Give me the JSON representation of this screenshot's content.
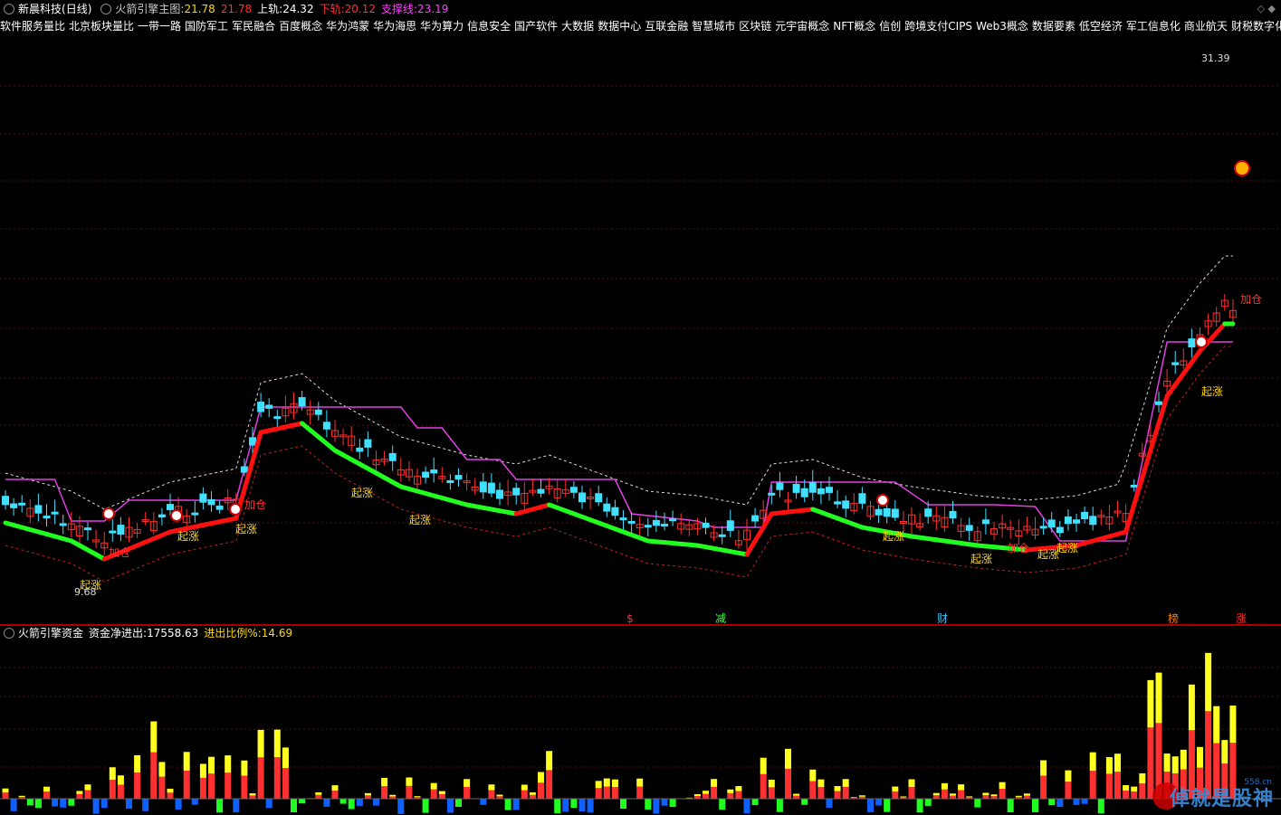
{
  "header": {
    "stock": "新晨科技",
    "period": "(日线)",
    "indicator": "火箭引擎主图",
    "close_prefix": ":",
    "close_value": "21.78",
    "close_value2": "21.78",
    "upper_label": "上轨:",
    "upper_value": "24.32",
    "lower_label": "下轨:",
    "lower_value": "20.12",
    "support_label": "支撑线:",
    "support_value": "23.19"
  },
  "concepts": [
    "软件服务量比",
    "北京板块量比",
    "一带一路",
    "国防军工",
    "军民融合",
    "百度概念",
    "华为鸿蒙",
    "华为海思",
    "华为算力",
    "信息安全",
    "国产软件",
    "大数据",
    "数据中心",
    "互联金融",
    "智慧城市",
    "区块链",
    "元宇宙概念",
    "NFT概念",
    "信创",
    "跨境支付CIPS",
    "Web3概念",
    "数据要素",
    "低空经济",
    "军工信息化",
    "商业航天",
    "财税数字化"
  ],
  "sub_header": {
    "indicator": "火箭引擎资金",
    "net_label": "资金净进出:",
    "net_value": "17558.63",
    "ratio_label": "进出比例%:",
    "ratio_value": "14.69"
  },
  "markers": {
    "max_price": "31.39",
    "min_price": "9.68",
    "qizhang": "起涨",
    "jiacang": "加仓",
    "bottom_events": [
      "$",
      "减",
      "财",
      "榜",
      "涨"
    ]
  },
  "watermark": {
    "text": "倬就是股神",
    "small": "558.cn"
  },
  "colors": {
    "up": "#ff3030",
    "down": "#40e0ff",
    "magenta": "#e040e0",
    "green_line": "#20ff20",
    "red_line": "#ff1010",
    "yellow": "#ffff20",
    "blue": "#1060ff"
  },
  "chart_data": {
    "type": "candlestick",
    "title": "火箭引擎主图",
    "price_range": [
      9.68,
      31.39
    ],
    "max_marker": 31.39,
    "min_marker": 9.68,
    "last": {
      "close": 21.78,
      "upper": 24.32,
      "lower": 20.12,
      "support": 23.19
    },
    "funds": {
      "net": 17558.63,
      "ratio_pct": 14.69
    }
  }
}
